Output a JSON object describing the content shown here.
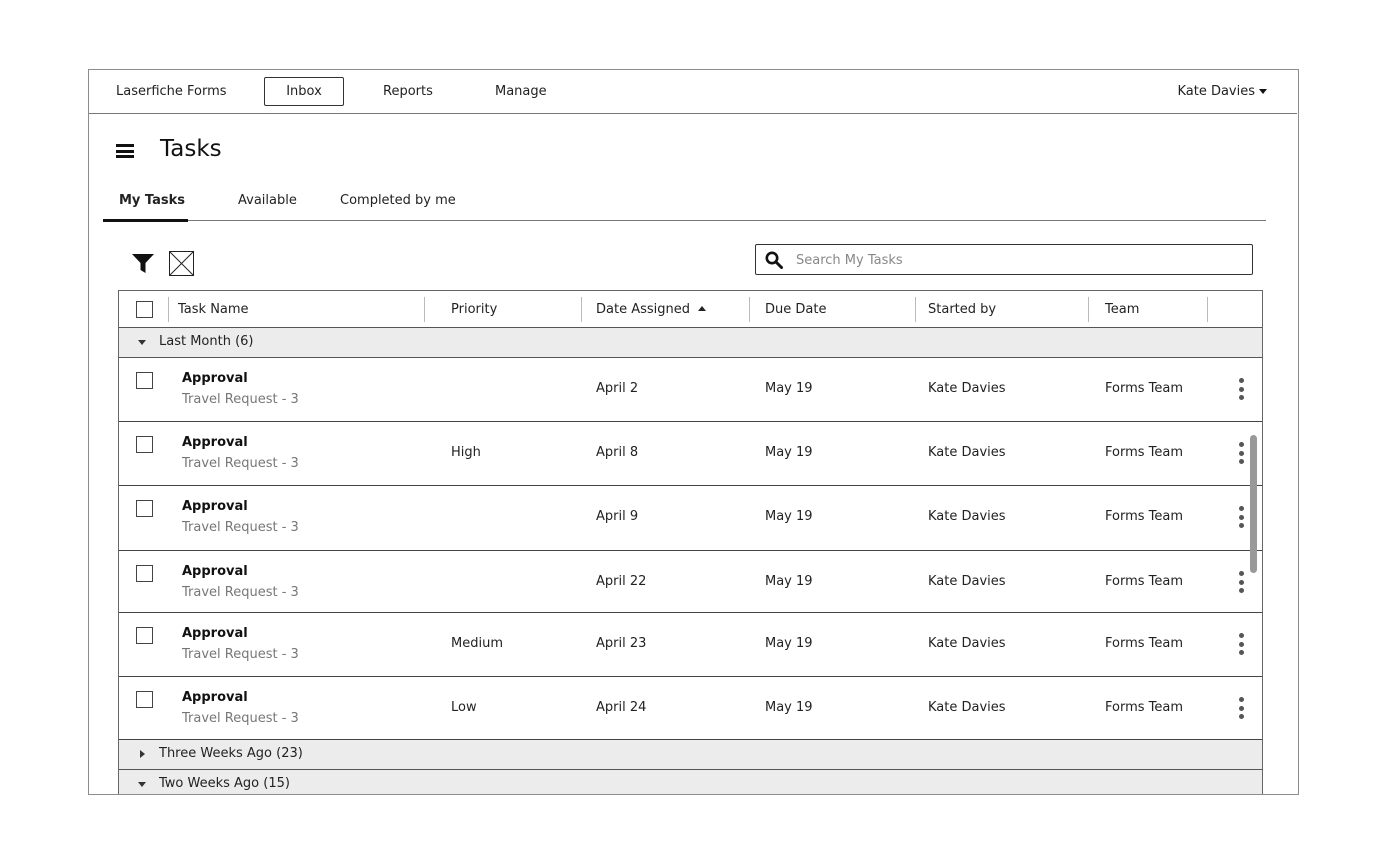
{
  "topnav": {
    "brand": "Laserfiche Forms",
    "items": [
      {
        "label": "Inbox",
        "active": true
      },
      {
        "label": "Reports",
        "active": false
      },
      {
        "label": "Manage",
        "active": false
      }
    ],
    "user": "Kate Davies"
  },
  "page": {
    "title": "Tasks",
    "menu_icon": "hamburger-icon"
  },
  "tabs": [
    {
      "label": "My Tasks",
      "active": true
    },
    {
      "label": "Available",
      "active": false
    },
    {
      "label": "Completed by me",
      "active": false
    }
  ],
  "toolbar": {
    "filter_icon": "filter-icon",
    "clear_icon": "clear-filter-icon",
    "search": {
      "placeholder": "Search My Tasks",
      "value": ""
    }
  },
  "table": {
    "columns": [
      "Task Name",
      "Priority",
      "Date Assigned",
      "Due Date",
      "Started by",
      "Team"
    ],
    "sorted_column": "Date Assigned",
    "sort_direction": "ascending",
    "groups": [
      {
        "label": "Last Month (6)",
        "expanded": true,
        "rows": [
          {
            "name": "Approval",
            "sub": "Travel Request - 3",
            "priority": "",
            "assigned": "April 2",
            "due": "May 19",
            "started_by": "Kate Davies",
            "team": "Forms Team"
          },
          {
            "name": "Approval",
            "sub": "Travel Request - 3",
            "priority": "High",
            "assigned": "April 8",
            "due": "May 19",
            "started_by": "Kate Davies",
            "team": "Forms Team"
          },
          {
            "name": "Approval",
            "sub": "Travel Request - 3",
            "priority": "",
            "assigned": "April 9",
            "due": "May 19",
            "started_by": "Kate Davies",
            "team": "Forms Team"
          },
          {
            "name": "Approval",
            "sub": "Travel Request - 3",
            "priority": "",
            "assigned": "April 22",
            "due": "May 19",
            "started_by": "Kate Davies",
            "team": "Forms Team"
          },
          {
            "name": "Approval",
            "sub": "Travel Request - 3",
            "priority": "Medium",
            "assigned": "April 23",
            "due": "May 19",
            "started_by": "Kate Davies",
            "team": "Forms Team"
          },
          {
            "name": "Approval",
            "sub": "Travel Request - 3",
            "priority": "Low",
            "assigned": "April 24",
            "due": "May 19",
            "started_by": "Kate Davies",
            "team": "Forms Team"
          }
        ]
      },
      {
        "label": "Three Weeks Ago (23)",
        "expanded": false,
        "rows": []
      },
      {
        "label": "Two Weeks Ago (15)",
        "expanded": true,
        "rows": []
      }
    ]
  }
}
